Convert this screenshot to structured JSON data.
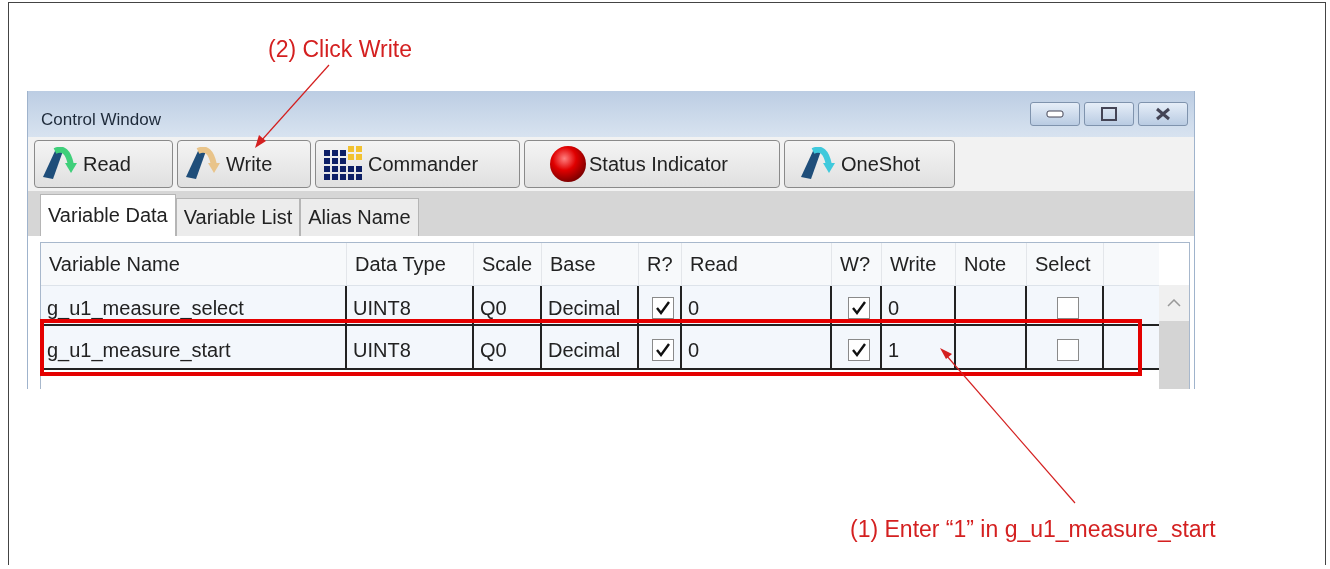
{
  "annotations": [
    {
      "text": "(2) Click Write"
    },
    {
      "text": "(1) Enter “1” in g_u1_measure_start"
    }
  ],
  "window": {
    "title": "Control Window"
  },
  "toolbar": [
    {
      "label": "Read",
      "kind": "read"
    },
    {
      "label": "Write",
      "kind": "write"
    },
    {
      "label": "Commander",
      "kind": "commander"
    },
    {
      "label": "Status Indicator",
      "kind": "status"
    },
    {
      "label": "OneShot",
      "kind": "oneshot"
    }
  ],
  "tabs": [
    {
      "label": "Variable Data",
      "selected": true
    },
    {
      "label": "Variable List",
      "selected": false
    },
    {
      "label": "Alias Name",
      "selected": false
    }
  ],
  "table": {
    "columns": [
      "Variable Name",
      "Data Type",
      "Scale",
      "Base",
      "R?",
      "Read",
      "W?",
      "Write",
      "Note",
      "Select"
    ],
    "rows": [
      {
        "variable_name": "g_u1_measure_select",
        "data_type": "UINT8",
        "scale": "Q0",
        "base": "Decimal",
        "r_checked": true,
        "read": "0",
        "w_checked": true,
        "write": "0",
        "select_checked": false,
        "highlighted": false
      },
      {
        "variable_name": "g_u1_measure_start",
        "data_type": "UINT8",
        "scale": "Q0",
        "base": "Decimal",
        "r_checked": true,
        "read": "0",
        "w_checked": true,
        "write": "1",
        "select_checked": false,
        "highlighted": true
      }
    ]
  }
}
